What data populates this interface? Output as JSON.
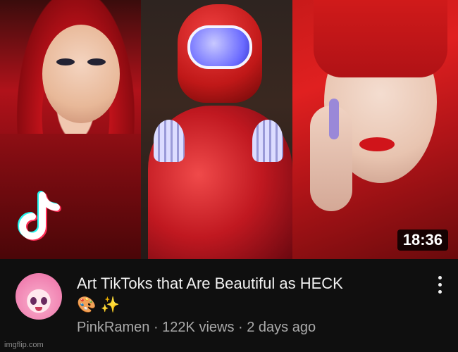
{
  "video": {
    "title": "Art TikToks that Are Beautiful as HECK",
    "title_emojis": "🎨 ✨",
    "duration": "18:36",
    "channel": "PinkRamen",
    "separator": " · ",
    "views": "122K views",
    "age": "2 days ago"
  },
  "watermark": "imgflip.com",
  "icons": {
    "menu": "more-vert-icon",
    "tiktok": "tiktok-logo",
    "avatar": "channel-avatar"
  },
  "colors": {
    "background": "#0f0f0f",
    "title": "#f1f1f1",
    "meta": "#aaaaaa"
  }
}
